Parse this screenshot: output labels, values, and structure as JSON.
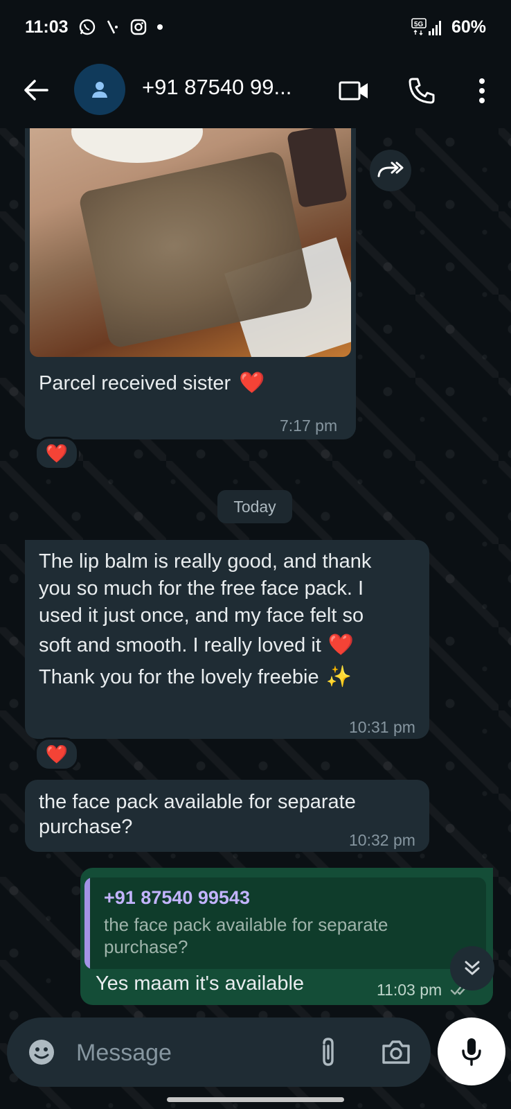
{
  "status_bar": {
    "time": "11:03",
    "network": "5G",
    "battery": "60%",
    "icons": [
      "whatsapp-icon",
      "missed-call-icon",
      "instagram-icon",
      "dot-icon",
      "signal-icon"
    ]
  },
  "header": {
    "contact_name": "+91 87540 99...",
    "icons": [
      "back-arrow-icon",
      "avatar-icon",
      "video-call-icon",
      "phone-icon",
      "more-vert-icon"
    ]
  },
  "messages": [
    {
      "direction": "in",
      "has_image": true,
      "text": "Parcel received sister",
      "emoji": "❤️",
      "time": "7:17 pm",
      "reaction": "❤️"
    },
    {
      "type": "date_chip",
      "label": "Today"
    },
    {
      "direction": "in",
      "lines": [
        "The lip balm is really good, and thank",
        "you so much for the free face pack. I",
        "used it just once, and my face felt so",
        "soft and smooth. I really loved it",
        "Thank you for the lovely freebie"
      ],
      "emoji_1": "❤️",
      "emoji_2": "✨",
      "time": "10:31 pm",
      "reaction": "❤️"
    },
    {
      "direction": "in",
      "lines": [
        "the face pack available for separate",
        "purchase?"
      ],
      "time": "10:32 pm"
    },
    {
      "direction": "out",
      "quote_author": "+91 87540 99543",
      "quote_lines": [
        "the face pack available for separate",
        "purchase?"
      ],
      "text": "Yes maam it's available",
      "time": "11:03 pm",
      "read_status": "read"
    }
  ],
  "input": {
    "placeholder": "Message"
  },
  "colors": {
    "background": "#0b1014",
    "incoming_bubble": "#1f2c34",
    "outgoing_bubble": "#144d37",
    "quote_bar": "#a393e6",
    "read_ticks": "#53bdeb"
  }
}
